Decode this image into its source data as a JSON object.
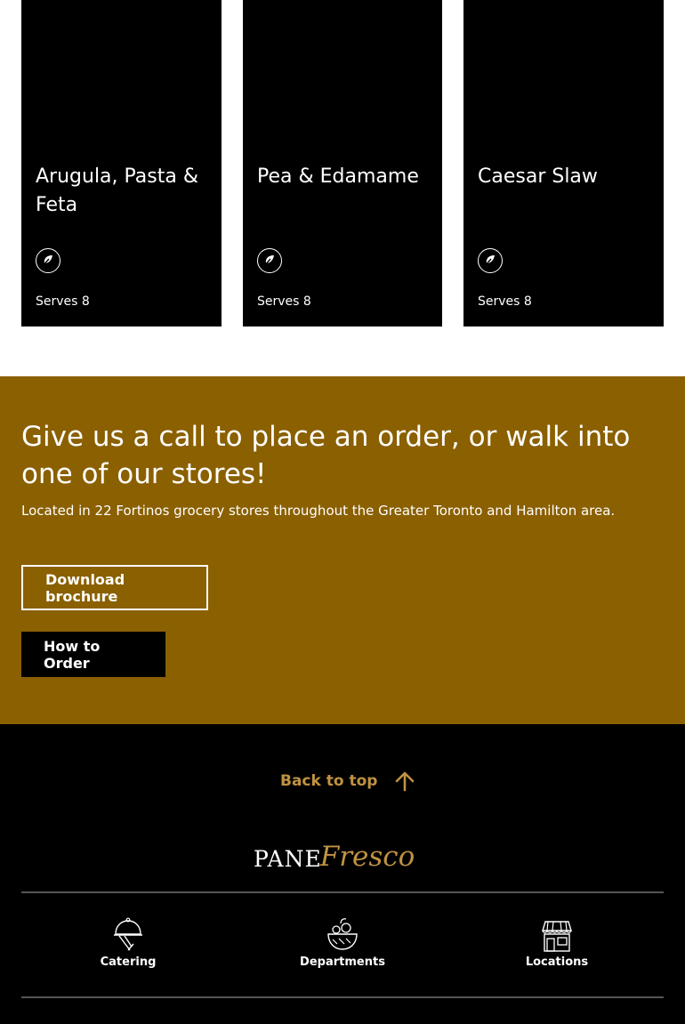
{
  "cards": [
    {
      "title": "Arugula, Pasta & Feta",
      "serves": "Serves 8",
      "icon": "leaf-icon"
    },
    {
      "title": "Pea & Edamame",
      "serves": "Serves 8",
      "icon": "leaf-icon"
    },
    {
      "title": "Caesar Slaw",
      "serves": "Serves 8",
      "icon": "leaf-icon"
    }
  ],
  "cta": {
    "heading": "Give us a call to place an order, or walk into one of our stores!",
    "subtext": "Located in 22 Fortinos grocery stores throughout the Greater Toronto and Hamilton area.",
    "download_label": "Download brochure",
    "order_label": "How to Order",
    "background_color": "#8a6000"
  },
  "footer": {
    "back_to_top": "Back to top",
    "logo_pane": "PANE",
    "logo_fresco": "Fresco",
    "accent_color": "#c09243",
    "nav": [
      {
        "label": "Catering",
        "icon": "catering-cloche-icon"
      },
      {
        "label": "Departments",
        "icon": "departments-bowl-icon"
      },
      {
        "label": "Locations",
        "icon": "store-icon"
      }
    ]
  }
}
